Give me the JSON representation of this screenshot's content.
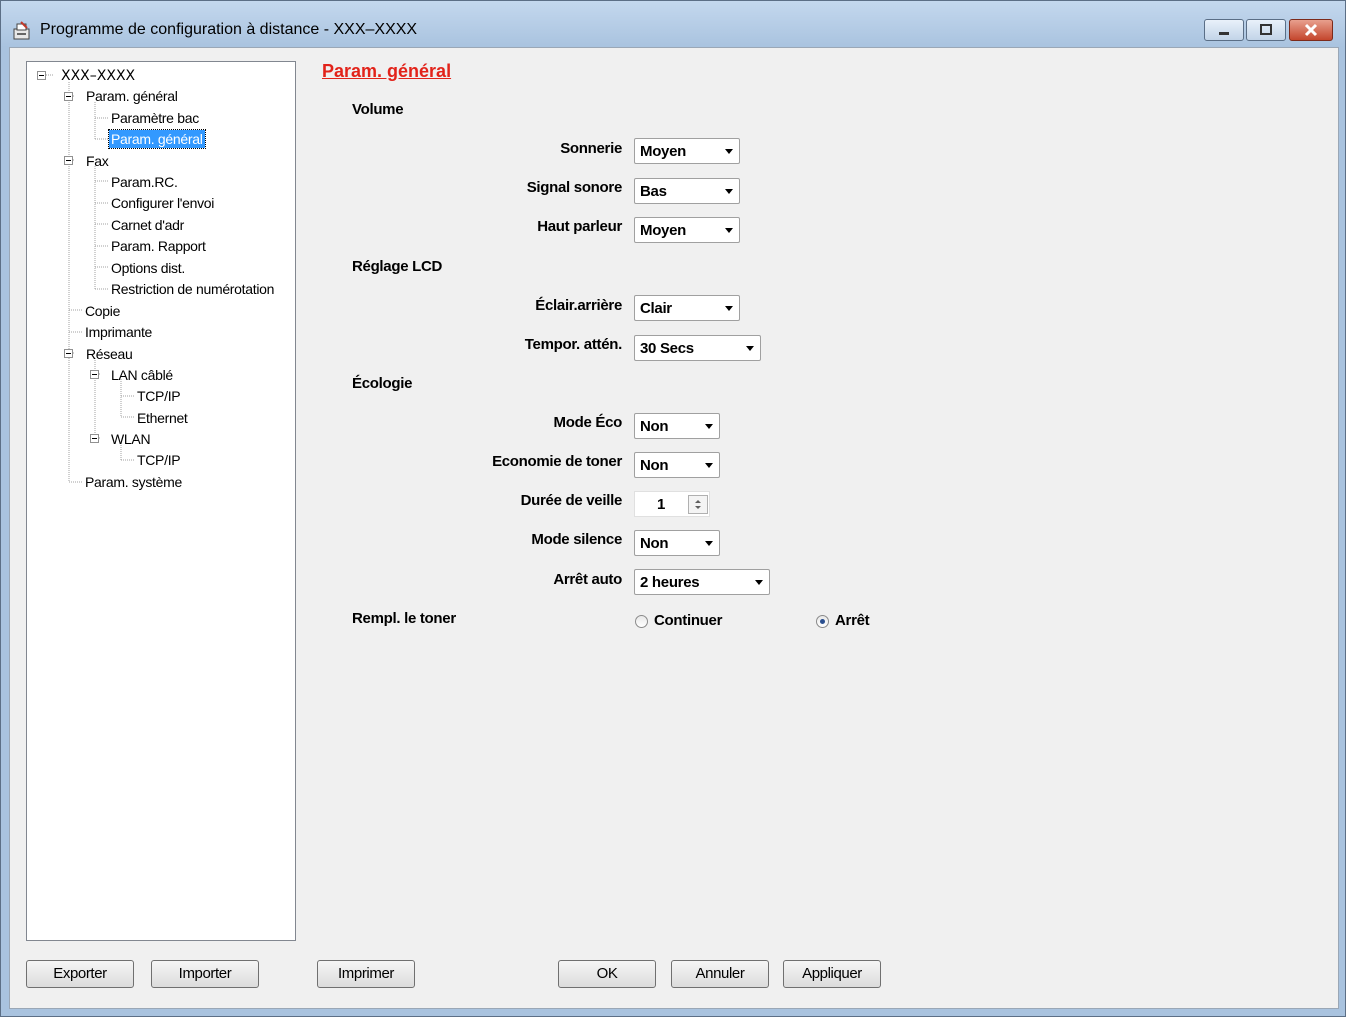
{
  "window": {
    "title": "Programme de configuration à distance - XXX–XXXX",
    "buttons": [
      "minimize",
      "maximize",
      "close"
    ]
  },
  "tree": {
    "root": "XXX–XXXX",
    "items": {
      "param_general": "Param. général",
      "parametre_bac": "Paramètre bac",
      "param_general_sub": "Param. général",
      "fax": "Fax",
      "param_rc": "Param.RC.",
      "configurer_envoi": "Configurer l'envoi",
      "carnet_adr": "Carnet d'adr",
      "param_rapport": "Param. Rapport",
      "options_dist": "Options dist.",
      "restriction": "Restriction de numérotation",
      "copie": "Copie",
      "imprimante": "Imprimante",
      "reseau": "Réseau",
      "lan_cable": "LAN câblé",
      "tcpip_lan": "TCP/IP",
      "ethernet": "Ethernet",
      "wlan": "WLAN",
      "tcpip_wlan": "TCP/IP",
      "param_systeme": "Param. système"
    },
    "selected": "Param. général"
  },
  "panel": {
    "title": "Param. général",
    "groups": {
      "volume": "Volume",
      "lcd": "Réglage LCD",
      "ecologie": "Écologie",
      "toner": "Rempl. le toner"
    },
    "fields": {
      "sonnerie": {
        "label": "Sonnerie",
        "value": "Moyen"
      },
      "signal_sonore": {
        "label": "Signal sonore",
        "value": "Bas"
      },
      "haut_parleur": {
        "label": "Haut parleur",
        "value": "Moyen"
      },
      "eclair_arriere": {
        "label": "Éclair.arrière",
        "value": "Clair"
      },
      "tempor_atten": {
        "label": "Tempor. attén.",
        "value": "30 Secs"
      },
      "mode_eco": {
        "label": "Mode Éco",
        "value": "Non"
      },
      "economie_toner": {
        "label": "Economie de toner",
        "value": "Non"
      },
      "duree_veille": {
        "label": "Durée de veille",
        "value": "1"
      },
      "mode_silence": {
        "label": "Mode silence",
        "value": "Non"
      },
      "arret_auto": {
        "label": "Arrêt auto",
        "value": "2 heures"
      }
    },
    "toner_options": {
      "continuer": "Continuer",
      "arret": "Arrêt",
      "selected": "Arrêt"
    }
  },
  "buttons": {
    "exporter": "Exporter",
    "importer": "Importer",
    "imprimer": "Imprimer",
    "ok": "OK",
    "annuler": "Annuler",
    "appliquer": "Appliquer"
  }
}
